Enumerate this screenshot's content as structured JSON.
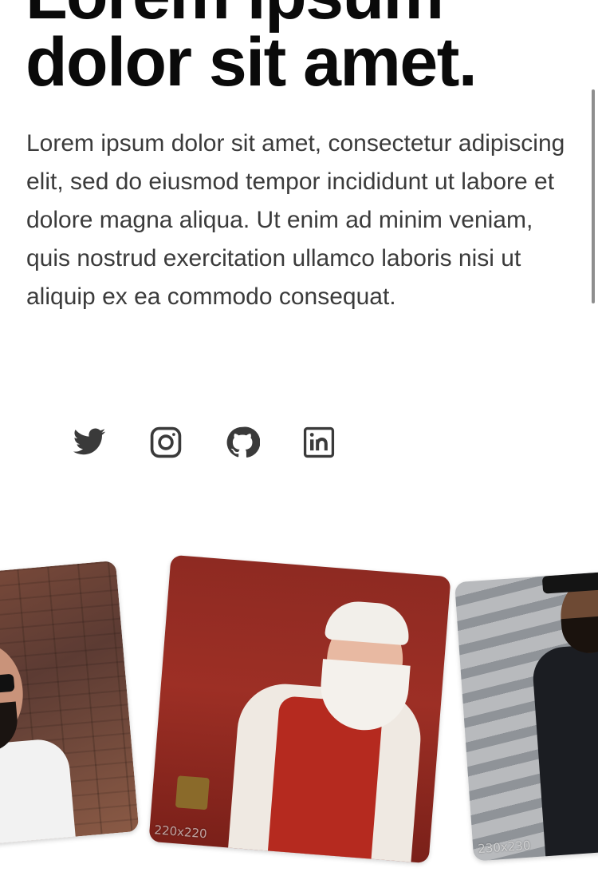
{
  "hero": {
    "title_line1": "Lorem ipsum",
    "title_line2": "dolor sit amet.",
    "body": "Lorem ipsum dolor sit amet, consectetur adipiscing elit, sed do eiusmod tempor incididunt ut labore et dolore magna aliqua. Ut enim ad minim veniam, quis nostrud exercitation ullamco laboris nisi ut aliquip ex ea commodo consequat."
  },
  "social": {
    "items": [
      {
        "name": "twitter",
        "icon": "twitter-icon"
      },
      {
        "name": "instagram",
        "icon": "instagram-icon"
      },
      {
        "name": "github",
        "icon": "github-icon"
      },
      {
        "name": "linkedin",
        "icon": "linkedin-icon"
      }
    ],
    "icon_color": "#3a3a3a"
  },
  "photos": [
    {
      "caption": ""
    },
    {
      "caption": "220x220"
    },
    {
      "caption": "230x230"
    }
  ]
}
